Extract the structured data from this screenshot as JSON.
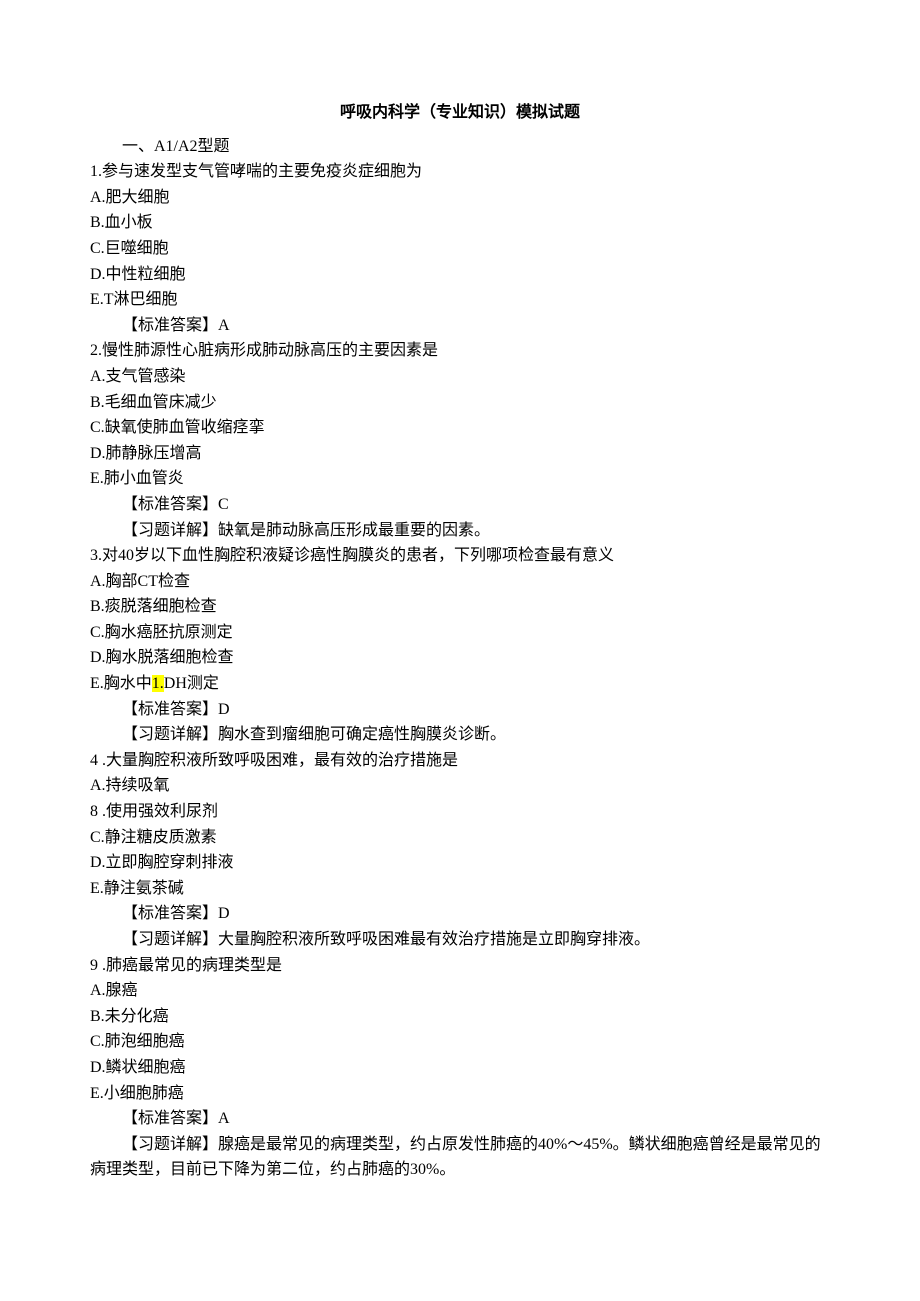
{
  "title": "呼吸内科学（专业知识）模拟试题",
  "section_heading": "一、A1/A2型题",
  "q1": {
    "stem": "1.参与速发型支气管哮喘的主要免疫炎症细胞为",
    "A": "A.肥大细胞",
    "B": "B.血小板",
    "C": "C.巨噬细胞",
    "D": "D.中性粒细胞",
    "E": "E.T淋巴细胞",
    "answer": "【标准答案】A"
  },
  "q2": {
    "stem": "2.慢性肺源性心脏病形成肺动脉高压的主要因素是",
    "A": "A.支气管感染",
    "B": "B.毛细血管床减少",
    "C": "C.缺氧使肺血管收缩痉挛",
    "D": "D.肺静脉压增高",
    "E": "E.肺小血管炎",
    "answer": "【标准答案】C",
    "explain": "【习题详解】缺氧是肺动脉高压形成最重要的因素。"
  },
  "q3": {
    "stem": "3.对40岁以下血性胸腔积液疑诊癌性胸膜炎的患者，下列哪项检查最有意义",
    "A": "A.胸部CT检查",
    "B": "B.痰脱落细胞检查",
    "C": "C.胸水癌胚抗原测定",
    "D": "D.胸水脱落细胞检查",
    "E_pre": "E.胸水中",
    "E_hl": "1.",
    "E_post": "DH测定",
    "answer": "【标准答案】D",
    "explain": "【习题详解】胸水查到瘤细胞可确定癌性胸膜炎诊断。"
  },
  "q4": {
    "stem": "4 .大量胸腔积液所致呼吸困难，最有效的治疗措施是",
    "A": "A.持续吸氧",
    "B": "8 .使用强效利尿剂",
    "C": "C.静注糖皮质激素",
    "D": "D.立即胸腔穿刺排液",
    "E": "E.静注氨茶碱",
    "answer": "【标准答案】D",
    "explain": "【习题详解】大量胸腔积液所致呼吸困难最有效治疗措施是立即胸穿排液。"
  },
  "q5": {
    "stem": "9 .肺癌最常见的病理类型是",
    "A": "A.腺癌",
    "B": "B.未分化癌",
    "C": "C.肺泡细胞癌",
    "D": "D.鳞状细胞癌",
    "E": "E.小细胞肺癌",
    "answer": "【标准答案】A",
    "explain": "【习题详解】腺癌是最常见的病理类型，约占原发性肺癌的40%～45%。鳞状细胞癌曾经是最常见的病理类型，目前已下降为第二位，约占肺癌的30%。"
  }
}
